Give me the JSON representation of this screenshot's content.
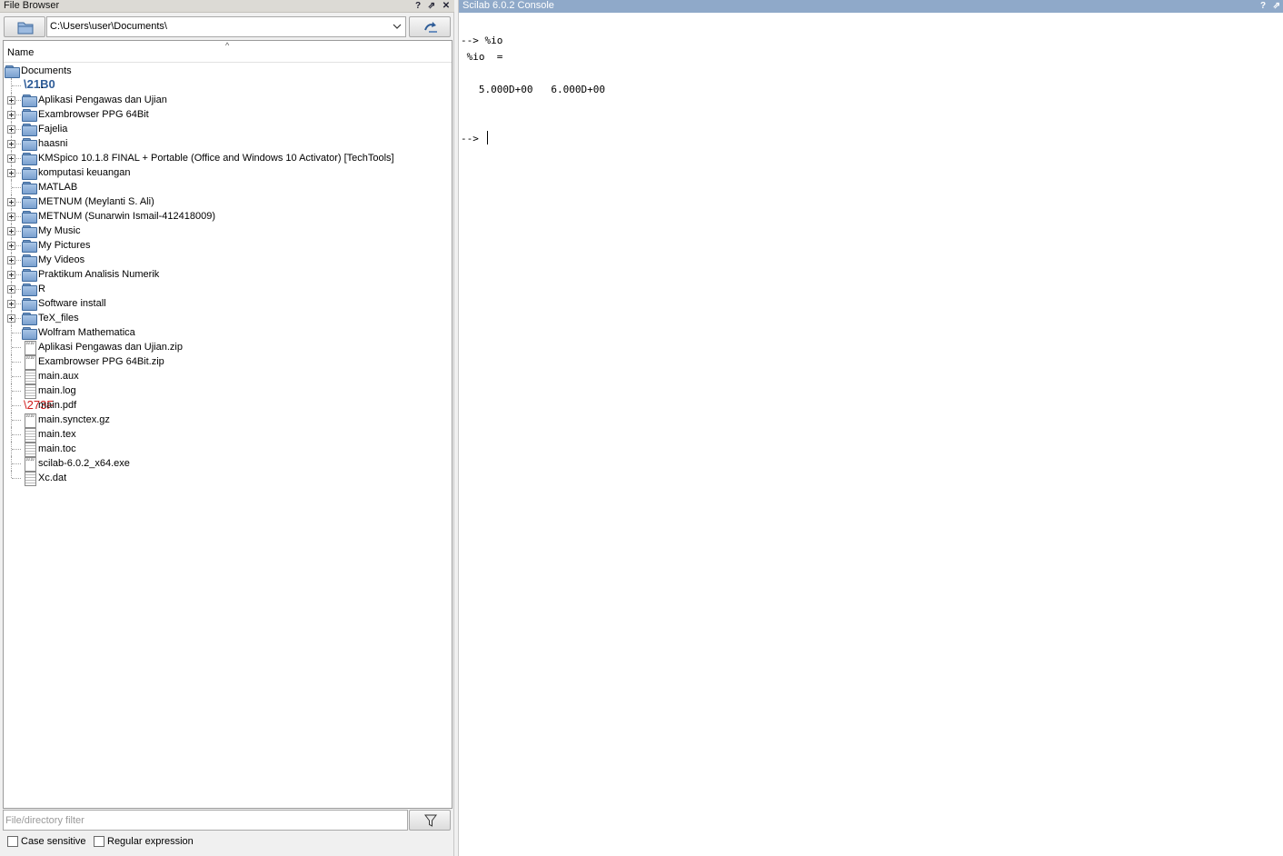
{
  "file_browser": {
    "title": "File Browser",
    "title_buttons": [
      "?",
      "⇗",
      "✕"
    ],
    "path": "C:\\Users\\user\\Documents\\",
    "column_header": "Name",
    "sort_indicator": "^",
    "root": "Documents",
    "items": [
      {
        "label": "..",
        "type": "up",
        "expandable": false
      },
      {
        "label": "Aplikasi Pengawas dan Ujian",
        "type": "folder",
        "expandable": true
      },
      {
        "label": "Exambrowser PPG 64Bit",
        "type": "folder",
        "expandable": true
      },
      {
        "label": "Fajelia",
        "type": "folder",
        "expandable": true
      },
      {
        "label": "haasni",
        "type": "folder",
        "expandable": true
      },
      {
        "label": "KMSpico 10.1.8 FINAL + Portable (Office and Windows 10 Activator) [TechTools]",
        "type": "folder",
        "expandable": true
      },
      {
        "label": "komputasi keuangan",
        "type": "folder",
        "expandable": true
      },
      {
        "label": "MATLAB",
        "type": "folder",
        "expandable": false
      },
      {
        "label": "METNUM (Meylanti S. Ali)",
        "type": "folder",
        "expandable": true
      },
      {
        "label": "METNUM (Sunarwin Ismail-412418009)",
        "type": "folder",
        "expandable": true
      },
      {
        "label": "My Music",
        "type": "folder",
        "expandable": true
      },
      {
        "label": "My Pictures",
        "type": "folder",
        "expandable": true
      },
      {
        "label": "My Videos",
        "type": "folder",
        "expandable": true
      },
      {
        "label": "Praktikum Analisis Numerik",
        "type": "folder",
        "expandable": true
      },
      {
        "label": "R",
        "type": "folder",
        "expandable": true
      },
      {
        "label": "Software install",
        "type": "folder",
        "expandable": true
      },
      {
        "label": "TeX_files",
        "type": "folder",
        "expandable": true
      },
      {
        "label": "Wolfram Mathematica",
        "type": "folder",
        "expandable": false
      },
      {
        "label": "Aplikasi Pengawas dan Ujian.zip",
        "type": "binary",
        "expandable": false
      },
      {
        "label": "Exambrowser PPG 64Bit.zip",
        "type": "binary",
        "expandable": false
      },
      {
        "label": "main.aux",
        "type": "file",
        "expandable": false
      },
      {
        "label": "main.log",
        "type": "file",
        "expandable": false
      },
      {
        "label": "main.pdf",
        "type": "pdf",
        "expandable": false
      },
      {
        "label": "main.synctex.gz",
        "type": "binary",
        "expandable": false
      },
      {
        "label": "main.tex",
        "type": "file",
        "expandable": false
      },
      {
        "label": "main.toc",
        "type": "file",
        "expandable": false
      },
      {
        "label": "scilab-6.0.2_x64.exe",
        "type": "binary",
        "expandable": false
      },
      {
        "label": "Xc.dat",
        "type": "file",
        "expandable": false
      }
    ],
    "filter_placeholder": "File/directory filter",
    "case_sensitive_label": "Case sensitive",
    "case_sensitive_checked": false,
    "regex_label": "Regular expression",
    "regex_checked": false
  },
  "console": {
    "title": "Scilab 6.0.2 Console",
    "title_buttons": [
      "?",
      "⇗"
    ],
    "lines": [
      "--> %io",
      " %io  =",
      "",
      "   5.000D+00   6.000D+00",
      "",
      "",
      "--> "
    ]
  },
  "colors": {
    "console_titlebar": "#8fa9c9",
    "filebrowser_titlebar": "#dcdad5",
    "folder_icon": "#7aa0cf",
    "pdf_icon": "#d01c1c"
  }
}
